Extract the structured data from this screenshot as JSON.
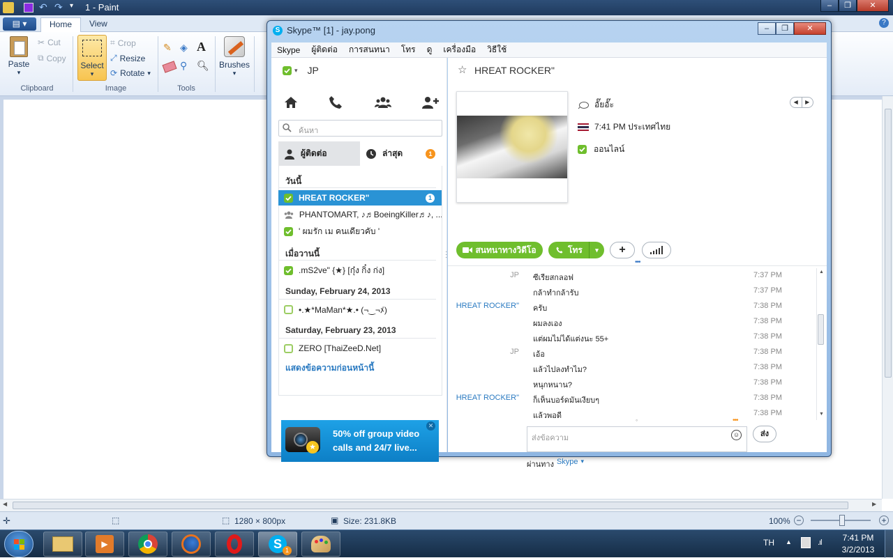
{
  "paint": {
    "title": "1 - Paint",
    "tabs": [
      "Home",
      "View"
    ],
    "clipboard": {
      "paste": "Paste",
      "cut": "Cut",
      "copy": "Copy",
      "label": "Clipboard"
    },
    "image": {
      "select": "Select",
      "crop": "Crop",
      "resize": "Resize",
      "rotate": "Rotate",
      "label": "Image"
    },
    "tools": {
      "label": "Tools"
    },
    "brushes": "Brushes",
    "status": {
      "dimensions": "1280 × 800px",
      "size": "Size: 231.8KB",
      "zoom": "100%"
    }
  },
  "taskbar": {
    "language": "TH",
    "time": "7:41 PM",
    "date": "3/2/2013",
    "skype_badge": "1"
  },
  "skype": {
    "title": "Skype™ [1] - jay.pong",
    "menu": [
      "Skype",
      "ผู้ติดต่อ",
      "การสนทนา",
      "โทร",
      "ดู",
      "เครื่องมือ",
      "วิธีใช้"
    ],
    "user": {
      "name": "JP"
    },
    "search_placeholder": "ค้นหา",
    "tabs": {
      "contacts": "ผู้ติดต่อ",
      "recent": "ล่าสุด",
      "recent_badge": "1"
    },
    "sections": {
      "today": "วันนี้",
      "yesterday": "เมื่อวานนี้",
      "sun": "Sunday, February 24, 2013",
      "sat": "Saturday, February 23, 2013"
    },
    "recent": {
      "hreat": "HREAT ROCKER\"",
      "hreat_badge": "1",
      "group": "PHANTOMART, ♪♬BoeingKiller♬♪, ...",
      "pomrak": "' ผมรัก เม คนเดียวคับ '",
      "ms2ve": ".mS2ve\" {★} [กุ๋ง กิ๋ง ก่ง]",
      "maman": "•.★*MaMan*★.• (¬‿¬ﾒ)",
      "zero": "ZERO [ThaiZeeD.Net]"
    },
    "show_older": "แสดงข้อความก่อนหน้านี้",
    "ad": {
      "text": "50% off group video calls and 24/7 live..."
    },
    "conversation": {
      "name": "HREAT ROCKER\"",
      "mood": "อั๊ยอั๊ะ",
      "local_time": "7:41 PM ประเทศไทย",
      "status": "ออนไลน์",
      "video_btn": "สนทนาทางวิดีโอ",
      "call_btn": "โทร"
    },
    "messages": [
      {
        "who": "JP",
        "text": "ซีเรียสกลอฟ",
        "time": "7:37 PM"
      },
      {
        "who": "",
        "text": "กล้าทำกล้ารับ",
        "time": "7:37 PM"
      },
      {
        "who": "HREAT ROCKER\"",
        "text": "ครับ",
        "time": "7:38 PM"
      },
      {
        "who": "",
        "text": "ผมลงเอง",
        "time": "7:38 PM"
      },
      {
        "who": "",
        "text": "แต่ผมไม่ได้แต่งนะ 55+",
        "time": "7:38 PM"
      },
      {
        "who": "JP",
        "text": "เอ้อ",
        "time": "7:38 PM"
      },
      {
        "who": "",
        "text": "แล้วไปลงทำไม?",
        "time": "7:38 PM"
      },
      {
        "who": "",
        "text": "หนุกหนาน?",
        "time": "7:38 PM"
      },
      {
        "who": "HREAT ROCKER\"",
        "text": "ก็เห็นบอร์ดมันเงียบๆ",
        "time": "7:38 PM"
      },
      {
        "who": "",
        "text": "แล้วพอดี",
        "time": "7:38 PM"
      }
    ],
    "input_placeholder": "ส่งข้อความ",
    "send": "ส่ง",
    "via_prefix": "ผ่านทาง",
    "via": "Skype"
  }
}
